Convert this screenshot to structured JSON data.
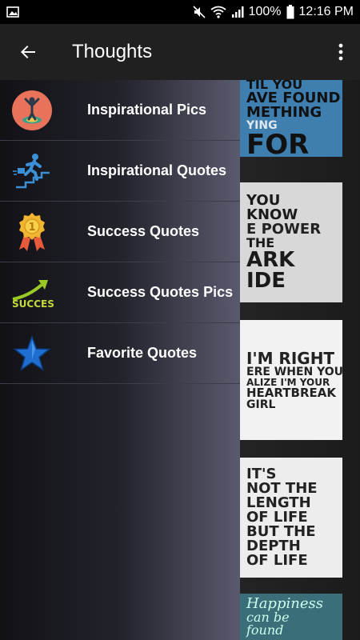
{
  "status_bar": {
    "battery": "100%",
    "time": "12:16 PM"
  },
  "app_bar": {
    "title": "Thoughts"
  },
  "drawer": {
    "items": [
      {
        "label": "Inspirational Pics",
        "icon": "person-target-icon"
      },
      {
        "label": "Inspirational Quotes",
        "icon": "climbing-stairs-icon"
      },
      {
        "label": "Success Quotes",
        "icon": "medal-icon"
      },
      {
        "label": "Success Quotes Pics",
        "icon": "success-arrow-icon"
      },
      {
        "label": "Favorite Quotes",
        "icon": "star-icon"
      }
    ]
  },
  "background_pics": [
    {
      "lines": [
        "TIL YOU",
        "AVE FOUND",
        "METHING",
        "YING",
        "FOR"
      ]
    },
    {
      "lines": [
        "YOU",
        "KNOW",
        "E POWER",
        "THE",
        "ARK",
        "IDE"
      ]
    },
    {
      "lines": [
        "I'M RIGHT",
        "ERE WHEN YOU",
        "ALIZE I'M YOUR",
        "HEARTBREAK",
        "GIRL"
      ]
    },
    {
      "lines": [
        "IT'S",
        "NOT THE",
        "LENGTH",
        "OF LIFE",
        "BUT THE",
        "DEPTH",
        "OF LIFE"
      ]
    },
    {
      "lines": [
        "Happiness",
        "can be",
        "found"
      ]
    }
  ],
  "colors": {
    "app_bar": "#202020",
    "status_bar": "#000000",
    "drawer_text": "#ffffff"
  }
}
